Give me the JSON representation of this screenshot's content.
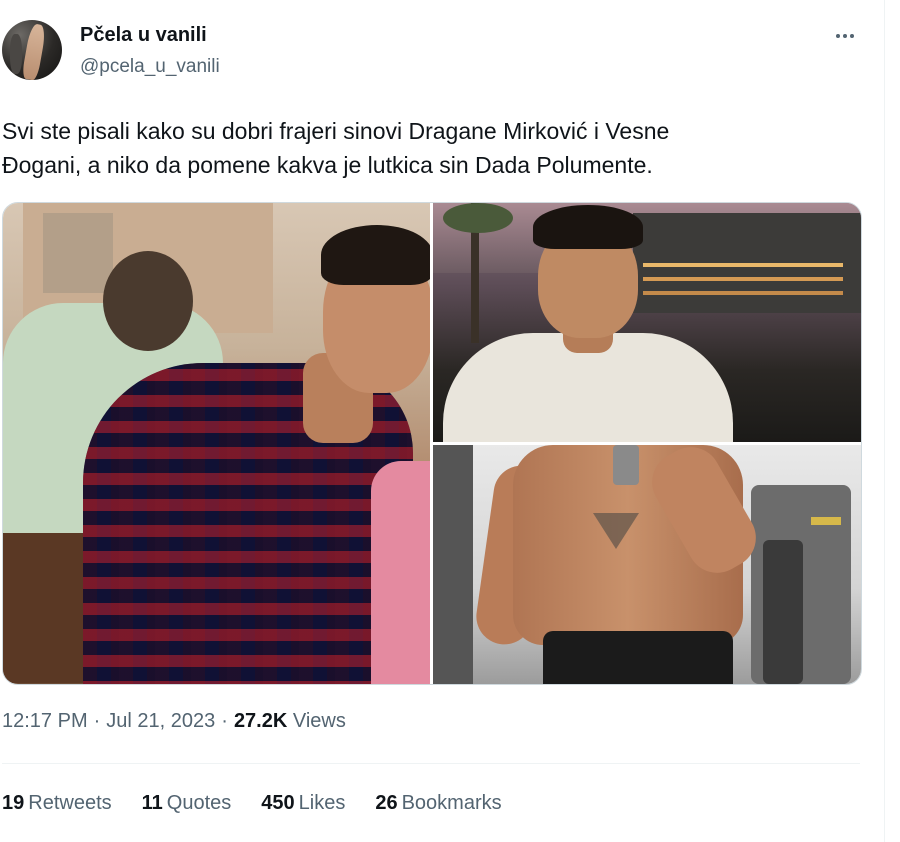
{
  "author": {
    "display_name": "Pčela u vanili",
    "handle": "@pcela_u_vanili"
  },
  "tweet": {
    "text": "Svi ste pisali kako su dobri frajeri sinovi Dragane Mirković i Vesne\nĐogani, a niko da pomene kakva je lutkica sin Dada Polumente."
  },
  "media": {
    "photos": [
      {
        "description": "smiling-man-plaid-shirt"
      },
      {
        "description": "man-white-shirt-night-harbor"
      },
      {
        "description": "gym-mirror-selfie"
      }
    ]
  },
  "meta": {
    "time": "12:17 PM",
    "separator": "·",
    "date": "Jul 21, 2023",
    "views_count": "27.2K",
    "views_label": "Views"
  },
  "stats": {
    "retweets_count": "19",
    "retweets_label": "Retweets",
    "quotes_count": "11",
    "quotes_label": "Quotes",
    "likes_count": "450",
    "likes_label": "Likes",
    "bookmarks_count": "26",
    "bookmarks_label": "Bookmarks"
  },
  "colors": {
    "text_primary": "#0f1419",
    "text_secondary": "#536471",
    "border": "#cfd9de"
  },
  "icons": {
    "more": "more-dots-icon"
  }
}
